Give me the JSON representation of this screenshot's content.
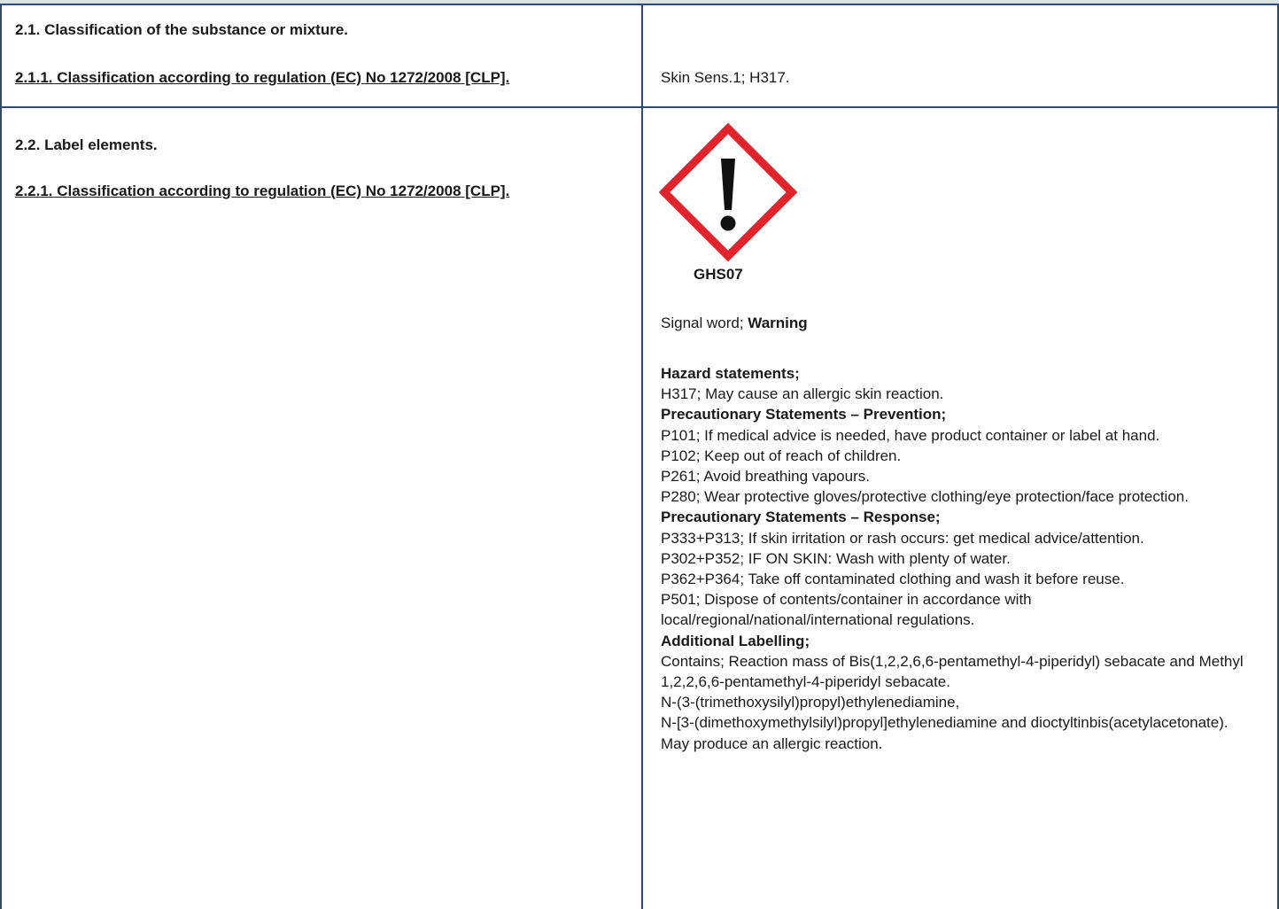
{
  "section_2_1": {
    "heading": "2.1. Classification of the substance or mixture.",
    "sub_heading": "2.1.1. Classification according to regulation (EC) No 1272/2008 [CLP].",
    "classification": "Skin Sens.1; H317."
  },
  "section_2_2": {
    "heading": "2.2. Label elements.",
    "sub_heading": "2.2.1. Classification according to regulation (EC) No 1272/2008 [CLP].",
    "pictogram": {
      "icon": "exclamation-mark-diamond-icon",
      "code": "GHS07",
      "color": "#e3232b"
    },
    "signal_word_label": "Signal word; ",
    "signal_word": "Warning",
    "hazard_heading": "Hazard statements;",
    "hazard_statements": [
      "H317; May cause an allergic skin reaction."
    ],
    "prevention_heading": "Precautionary Statements – Prevention;",
    "prevention_statements": [
      "P101; If medical advice is needed, have product container or label at hand.",
      "P102; Keep out of reach of children.",
      "P261; Avoid breathing vapours.",
      "P280; Wear protective gloves/protective clothing/eye protection/face protection."
    ],
    "response_heading": "Precautionary Statements – Response;",
    "response_statements": [
      "P333+P313; If skin irritation or rash occurs: get medical advice/attention.",
      "P302+P352; IF ON SKIN: Wash with plenty of water.",
      "P362+P364; Take off contaminated clothing and wash it before reuse.",
      "P501; Dispose of contents/container in accordance with local/regional/national/international regulations."
    ],
    "additional_heading": "Additional Labelling;",
    "additional_statements": [
      "Contains; Reaction mass of Bis(1,2,2,6,6-pentamethyl-4-piperidyl) sebacate and Methyl 1,2,2,6,6-pentamethyl-4-piperidyl sebacate.",
      "N-(3-(trimethoxysilyl)propyl)ethylenediamine,",
      "N-[3-(dimethoxymethylsilyl)propyl]ethylenediamine and dioctyltinbis(acetylacetonate).",
      "May produce an allergic reaction."
    ]
  },
  "colors": {
    "border": "#2f4b6e",
    "header_band": "#d9e1ec",
    "pictogram_red": "#e3232b"
  }
}
